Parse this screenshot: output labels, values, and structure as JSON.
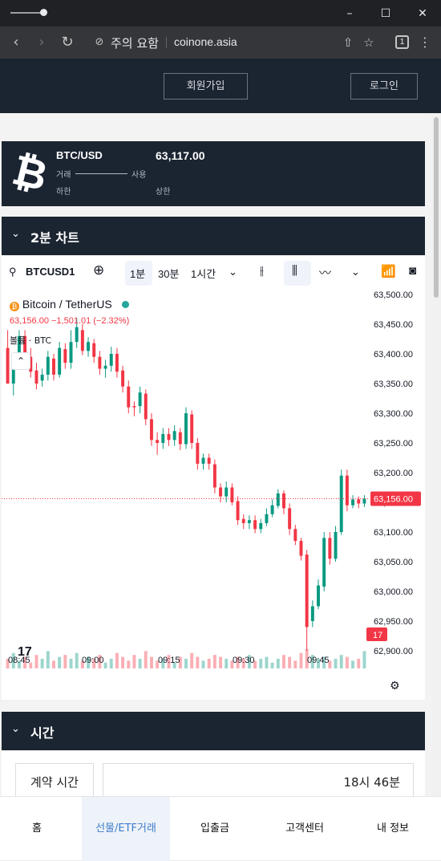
{
  "browser": {
    "warning": "주의 요함",
    "url": "coinone.asia",
    "tab_count": "1"
  },
  "header": {
    "signup": "회원가입",
    "login": "로그인"
  },
  "ticker": {
    "pair": "BTC/USD",
    "price": "63,117.00",
    "volume_label": "거래",
    "use_label": "사용",
    "low_label": "하한",
    "high_label": "상한"
  },
  "chart_section": {
    "title": "2분 차트"
  },
  "chart_toolbar": {
    "symbol": "BTCUSD1",
    "intervals": [
      "1분",
      "30분",
      "1시간"
    ]
  },
  "chart_legend": {
    "name": "Bitcoin / TetherUS",
    "quote": "63,156.00  −1,501.01 (−2.32%)",
    "volume": "볼륨 · BTC"
  },
  "chart_data": {
    "type": "candlestick",
    "y_ticks": [
      "63,500.00",
      "63,450.00",
      "63,400.00",
      "63,350.00",
      "63,300.00",
      "63,250.00",
      "63,200.00",
      "63,150.00",
      "63,100.00",
      "63,050.00",
      "63,000.00",
      "62,950.00",
      "62,900.00"
    ],
    "ylim": [
      62880,
      63520
    ],
    "x_ticks": [
      "08:45",
      "09:00",
      "09:15",
      "09:30",
      "09:45"
    ],
    "last_price": 63156,
    "last_price_label": "63,156.00",
    "volume_badge": "17",
    "candles": [
      [
        63410,
        63350,
        63390,
        63440
      ],
      [
        63350,
        63380,
        63330,
        63400
      ],
      [
        63385,
        63430,
        63380,
        63440
      ],
      [
        63430,
        63400,
        63390,
        63440
      ],
      [
        63395,
        63370,
        63360,
        63410
      ],
      [
        63372,
        63350,
        63340,
        63385
      ],
      [
        63355,
        63365,
        63345,
        63375
      ],
      [
        63365,
        63395,
        63355,
        63405
      ],
      [
        63392,
        63365,
        63355,
        63400
      ],
      [
        63365,
        63410,
        63360,
        63420
      ],
      [
        63408,
        63385,
        63375,
        63418
      ],
      [
        63385,
        63420,
        63375,
        63440
      ],
      [
        63420,
        63445,
        63410,
        63460
      ],
      [
        63440,
        63405,
        63398,
        63450
      ],
      [
        63405,
        63420,
        63395,
        63428
      ],
      [
        63418,
        63395,
        63385,
        63425
      ],
      [
        63395,
        63375,
        63365,
        63405
      ],
      [
        63375,
        63380,
        63360,
        63390
      ],
      [
        63380,
        63400,
        63370,
        63412
      ],
      [
        63400,
        63370,
        63360,
        63410
      ],
      [
        63372,
        63345,
        63335,
        63380
      ],
      [
        63345,
        63310,
        63300,
        63355
      ],
      [
        63312,
        63310,
        63295,
        63320
      ],
      [
        63312,
        63335,
        63300,
        63345
      ],
      [
        63333,
        63290,
        63280,
        63340
      ],
      [
        63290,
        63255,
        63245,
        63300
      ],
      [
        63255,
        63250,
        63230,
        63268
      ],
      [
        63250,
        63265,
        63240,
        63275
      ],
      [
        63265,
        63255,
        63245,
        63275
      ],
      [
        63255,
        63270,
        63245,
        63280
      ],
      [
        63268,
        63248,
        63238,
        63275
      ],
      [
        63248,
        63300,
        63240,
        63310
      ],
      [
        63298,
        63250,
        63240,
        63305
      ],
      [
        63250,
        63215,
        63205,
        63258
      ],
      [
        63215,
        63225,
        63205,
        63232
      ],
      [
        63225,
        63215,
        63205,
        63232
      ],
      [
        63214,
        63175,
        63165,
        63222
      ],
      [
        63175,
        63160,
        63150,
        63182
      ],
      [
        63160,
        63175,
        63150,
        63185
      ],
      [
        63175,
        63150,
        63145,
        63182
      ],
      [
        63152,
        63120,
        63112,
        63160
      ],
      [
        63122,
        63115,
        63105,
        63130
      ],
      [
        63115,
        63120,
        63105,
        63128
      ],
      [
        63120,
        63105,
        63098,
        63128
      ],
      [
        63105,
        63115,
        63098,
        63122
      ],
      [
        63115,
        63130,
        63110,
        63140
      ],
      [
        63130,
        63145,
        63125,
        63155
      ],
      [
        63144,
        63165,
        63140,
        63172
      ],
      [
        63165,
        63140,
        63130,
        63170
      ],
      [
        63140,
        63105,
        63095,
        63148
      ],
      [
        63105,
        63085,
        63078,
        63112
      ],
      [
        63085,
        63060,
        63052,
        63090
      ],
      [
        63062,
        62940,
        62900,
        63070
      ],
      [
        62950,
        62975,
        62940,
        62985
      ],
      [
        62975,
        63010,
        62970,
        63020
      ],
      [
        63008,
        63090,
        63000,
        63100
      ],
      [
        63090,
        63055,
        63045,
        63100
      ],
      [
        63055,
        63100,
        63050,
        63110
      ],
      [
        63100,
        63195,
        63095,
        63205
      ],
      [
        63195,
        63145,
        63135,
        63205
      ],
      [
        63145,
        63155,
        63140,
        63162
      ],
      [
        63155,
        63148,
        63140,
        63160
      ],
      [
        63148,
        63156,
        63142,
        63162
      ]
    ],
    "volumes": [
      5,
      8,
      4,
      6,
      3,
      7,
      5,
      9,
      4,
      6,
      7,
      5,
      8,
      4,
      6,
      5,
      7,
      3,
      5,
      8,
      6,
      4,
      7,
      5,
      9,
      6,
      4,
      5,
      7,
      3,
      6,
      5,
      8,
      6,
      4,
      5,
      7,
      6,
      5,
      4,
      6,
      5,
      7,
      4,
      5,
      6,
      3,
      5,
      7,
      6,
      4,
      8,
      10,
      7,
      5,
      6,
      4,
      5,
      7,
      6,
      4,
      5,
      9
    ]
  },
  "time_section": {
    "title": "시간",
    "contract_label": "계약 시간",
    "contract_value": "18시 46분"
  },
  "bottom_nav": {
    "items": [
      "홈",
      "선물/ETF거래",
      "입출금",
      "고객센터",
      "내 정보"
    ]
  }
}
